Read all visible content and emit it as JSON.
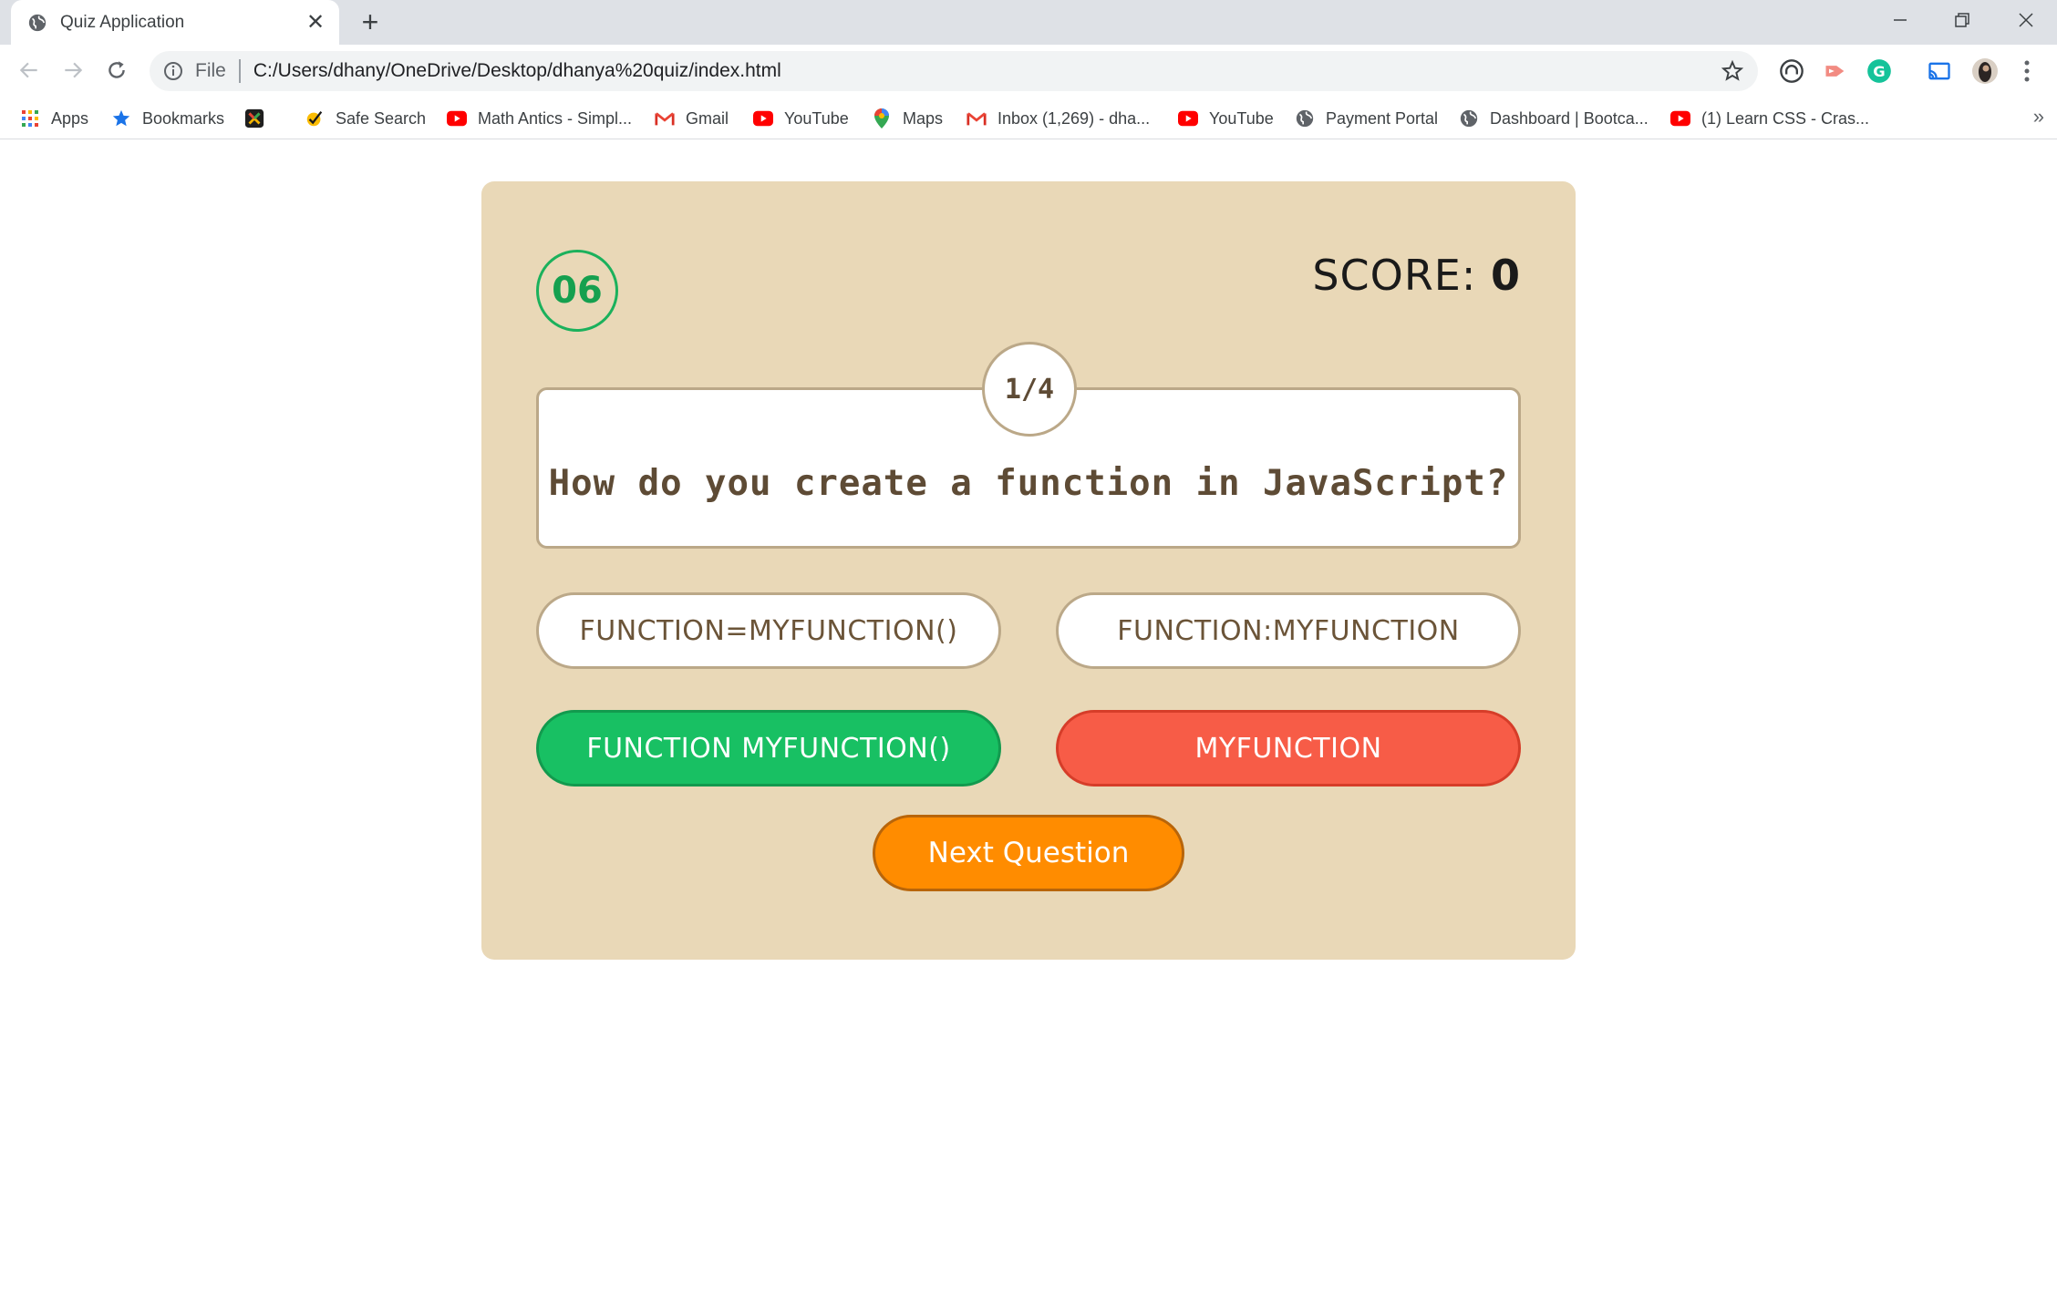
{
  "browser": {
    "tab_title": "Quiz Application",
    "address": {
      "scheme_label": "File",
      "url": "C:/Users/dhany/OneDrive/Desktop/dhanya%20quiz/index.html"
    },
    "bookmarks": [
      {
        "label": "Apps",
        "icon": "apps-grid-icon"
      },
      {
        "label": "Bookmarks",
        "icon": "star-icon"
      },
      {
        "label": "",
        "icon": "x-logo-icon"
      },
      {
        "label": "Safe Search",
        "icon": "safe-search-icon"
      },
      {
        "label": "Math Antics - Simpl...",
        "icon": "youtube-icon"
      },
      {
        "label": "Gmail",
        "icon": "gmail-icon"
      },
      {
        "label": "YouTube",
        "icon": "youtube-icon"
      },
      {
        "label": "Maps",
        "icon": "maps-pin-icon"
      },
      {
        "label": "Inbox (1,269) - dha...",
        "icon": "gmail-icon"
      },
      {
        "label": "YouTube",
        "icon": "youtube-icon"
      },
      {
        "label": "Payment Portal",
        "icon": "globe-icon"
      },
      {
        "label": "Dashboard | Bootca...",
        "icon": "globe-icon"
      },
      {
        "label": "(1) Learn CSS - Cras...",
        "icon": "youtube-icon"
      }
    ],
    "overflow_label": "»"
  },
  "quiz": {
    "timer": "06",
    "score": {
      "label": "SCORE: ",
      "value": "0"
    },
    "counter": "1/4",
    "question": "How do you create a function in JavaScript?",
    "options": [
      {
        "label": "FUNCTION=MYFUNCTION()",
        "state": "neutral"
      },
      {
        "label": "FUNCTION:MYFUNCTION",
        "state": "neutral"
      },
      {
        "label": "FUNCTION MYFUNCTION()",
        "state": "correct"
      },
      {
        "label": "MYFUNCTION",
        "state": "wrong"
      }
    ],
    "next_label": "Next Question"
  },
  "colors": {
    "card_bg": "#e9d8b7",
    "correct": "#18c063",
    "wrong": "#f75c47",
    "next": "#ff8c00",
    "timer": "#1bb15c"
  }
}
